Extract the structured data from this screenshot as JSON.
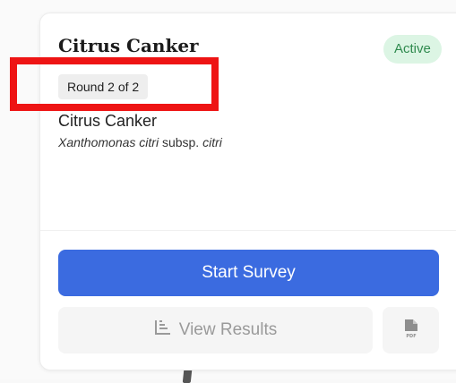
{
  "card": {
    "title": "Citrus Canker",
    "status": "Active",
    "round": "Round 2 of 2",
    "pathogen": {
      "common_name": "Citrus Canker",
      "genus_species": "Xanthomonas citri",
      "subsp_label": "subsp.",
      "subsp_name": "citri"
    }
  },
  "actions": {
    "start_survey": "Start Survey",
    "view_results": "View Results",
    "pdf_icon_label": "PDF"
  },
  "icons": {
    "view_results_icon": "bar-chart-icon",
    "pdf_icon": "pdf-file-icon"
  },
  "colors": {
    "primary": "#3b6be0",
    "status_bg": "#dcf5e4",
    "status_text": "#2f8a4e",
    "highlight": "#ee1414"
  }
}
